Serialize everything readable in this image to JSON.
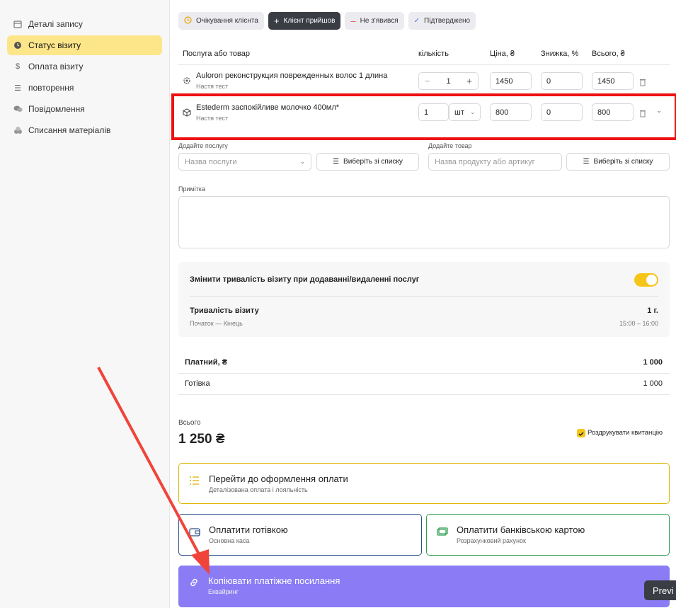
{
  "sidebar": {
    "items": [
      {
        "label": "Деталі запису",
        "icon": "calendar-icon"
      },
      {
        "label": "Статус візиту",
        "icon": "status-icon"
      },
      {
        "label": "Оплата візиту",
        "icon": "dollar-icon"
      },
      {
        "label": "повторення",
        "icon": "list-icon"
      },
      {
        "label": "Повідомлення",
        "icon": "chat-icon"
      },
      {
        "label": "Списання матеріалів",
        "icon": "coins-icon"
      }
    ]
  },
  "status": {
    "waiting": "Очікування клієнта",
    "arrived": "Клієнт прийшов",
    "noshow": "Не з'явився",
    "confirmed": "Підтверджено"
  },
  "table": {
    "headers": {
      "item": "Послуга або товар",
      "qty": "кількість",
      "price": "Ціна, ₴",
      "discount": "Знижка, %",
      "total": "Всього, ₴"
    },
    "rows": [
      {
        "title": "Auloron реконструкция поврежденных волос 1 длина",
        "sub": "Настя тест",
        "qty": "1",
        "price": "1450",
        "discount": "0",
        "total": "1450"
      },
      {
        "title": "Estederm заспокійливе молочко 400мл*",
        "sub": "Настя тест",
        "qty": "1",
        "unit": "шт",
        "price": "800",
        "discount": "0",
        "total": "800"
      }
    ]
  },
  "add": {
    "service_label": "Додайте послугу",
    "service_placeholder": "Назва послуги",
    "service_list": "Виберіть зі списку",
    "product_label": "Додайте товар",
    "product_placeholder": "Назва продукту або артикуг",
    "product_list": "Виберіть зі списку"
  },
  "note_label": "Примітка",
  "duration": {
    "toggle_label": "Змінити тривалість візиту при додаванні/видаленні послуг",
    "title": "Тривалість візиту",
    "value": "1 г.",
    "range_label": "Початок — Кінець",
    "range": "15:00 – 16:00"
  },
  "payments": [
    {
      "label": "Платний, ₴",
      "amount": "1 000",
      "bold": true
    },
    {
      "label": "Готівка",
      "amount": "1 000",
      "bold": false
    }
  ],
  "total": {
    "label": "Всього",
    "value": "1 250 ₴",
    "print_label": "Роздрукувати квитанцію"
  },
  "actions": {
    "checkout": {
      "title": "Перейти до оформлення оплати",
      "sub": "Деталізована оплата і лояльність"
    },
    "cash": {
      "title": "Оплатити готівкою",
      "sub": "Основна каса"
    },
    "card": {
      "title": "Оплатити банківською картою",
      "sub": "Розрахунковий рахунок"
    },
    "link": {
      "title": "Копіювати платіжне посилання",
      "sub": "Еквайринг"
    }
  },
  "preview_label": "Previ",
  "colors": {
    "accent": "#f5c518",
    "highlight": "#e11111",
    "link_button": "#8b7cf6",
    "cash_border": "#2b4f8a",
    "card_border": "#2f9e4f"
  }
}
